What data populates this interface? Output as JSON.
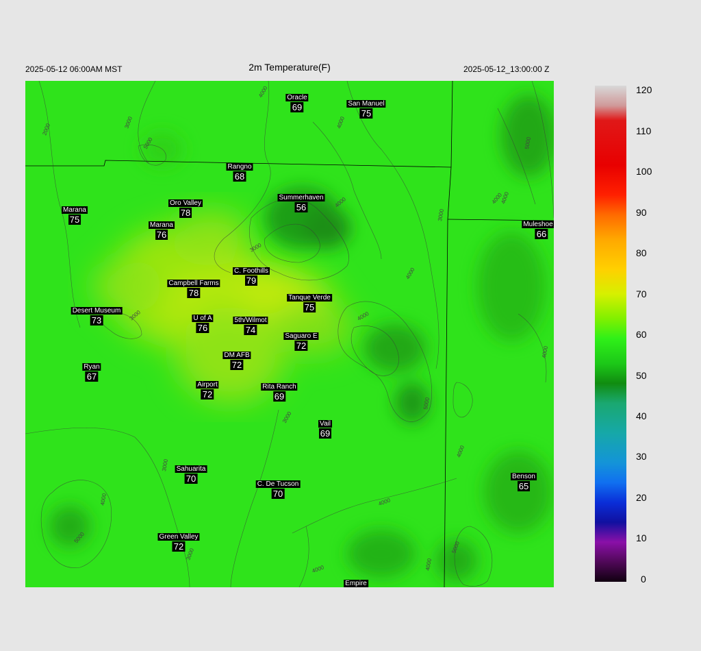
{
  "header": {
    "left_time": "2025-05-12 06:00AM MST",
    "title": "2m Temperature(F)",
    "right_time": "2025-05-12_13:00:00 Z"
  },
  "stations": [
    {
      "name": "Oracle",
      "value": "69"
    },
    {
      "name": "San Manuel",
      "value": "75"
    },
    {
      "name": "Rangno",
      "value": "68"
    },
    {
      "name": "Summerhaven",
      "value": "56"
    },
    {
      "name": "Marana",
      "value": "75"
    },
    {
      "name": "Oro Valley",
      "value": "78"
    },
    {
      "name": "Marana",
      "value": "76"
    },
    {
      "name": "Mulešhoe R",
      "value": "66"
    },
    {
      "name": "C. Foothills",
      "value": "79"
    },
    {
      "name": "Campbell Farms",
      "value": "78"
    },
    {
      "name": "Tanque Verde",
      "value": "75"
    },
    {
      "name": "Desert Museum",
      "value": "73"
    },
    {
      "name": "U of A",
      "value": "76"
    },
    {
      "name": "5th/Wilmot",
      "value": "74"
    },
    {
      "name": "Saguaro E",
      "value": "72"
    },
    {
      "name": "DM AFB",
      "value": "72"
    },
    {
      "name": "Ryan",
      "value": "67"
    },
    {
      "name": "Airport",
      "value": "72"
    },
    {
      "name": "Rita Ranch",
      "value": "69"
    },
    {
      "name": "Vail",
      "value": "69"
    },
    {
      "name": "Sahuarita",
      "value": "70"
    },
    {
      "name": "C. De Tucson",
      "value": "70"
    },
    {
      "name": "Benson",
      "value": "65"
    },
    {
      "name": "Green Valley",
      "value": "72"
    },
    {
      "name": "Empire",
      "value": ""
    }
  ],
  "contour_labels": [
    "2000",
    "3000",
    "4000",
    "5000",
    "6000"
  ],
  "colorbar": {
    "ticks": [
      "120",
      "110",
      "100",
      "90",
      "80",
      "70",
      "60",
      "50",
      "40",
      "30",
      "20",
      "10",
      "0"
    ]
  }
}
